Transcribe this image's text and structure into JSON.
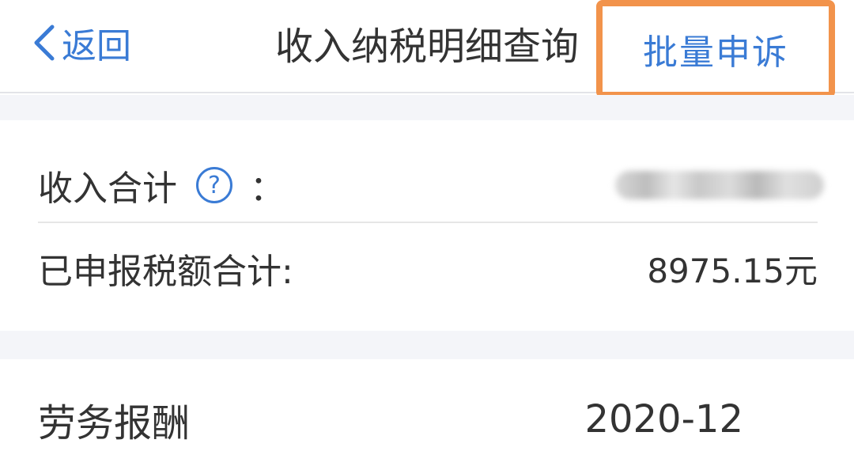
{
  "nav": {
    "back_label": "返回",
    "title": "收入纳税明细查询",
    "action_label": "批量申诉"
  },
  "summary": {
    "income_total_label": "收入合计",
    "help_icon": "?",
    "colon": "：",
    "income_total_value": "",
    "declared_tax_label": "已申报税额合计:",
    "declared_tax_value": "8975.15元"
  },
  "list": {
    "items": [
      {
        "type": "劳务报酬",
        "period": "2020-12"
      }
    ]
  },
  "colors": {
    "accent": "#3a7bd5",
    "highlight": "#f2934b",
    "text": "#333333",
    "divider_bg": "#f4f5f9"
  }
}
